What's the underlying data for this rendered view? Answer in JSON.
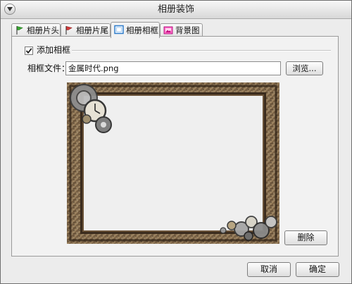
{
  "window": {
    "title": "相册装饰"
  },
  "tabs": [
    {
      "label": "相册片头",
      "icon": "green-flag-icon",
      "active": false
    },
    {
      "label": "相册片尾",
      "icon": "red-flag-icon",
      "active": false
    },
    {
      "label": "相册相框",
      "icon": "frame-icon",
      "active": true
    },
    {
      "label": "背景图",
      "icon": "picture-icon",
      "active": false
    }
  ],
  "frame_section": {
    "enable_label": "添加相框",
    "enabled": true,
    "file_label": "相框文件：",
    "file_value": "金属时代.png",
    "browse_label": "浏览...",
    "delete_label": "删除"
  },
  "footer": {
    "cancel_label": "取消",
    "ok_label": "确定"
  },
  "colors": {
    "frame_wood": "#8a6b48",
    "frame_dark": "#3f2f1f",
    "panel_bg": "#f2f2f2",
    "title_bg": "#dcdcdc"
  }
}
